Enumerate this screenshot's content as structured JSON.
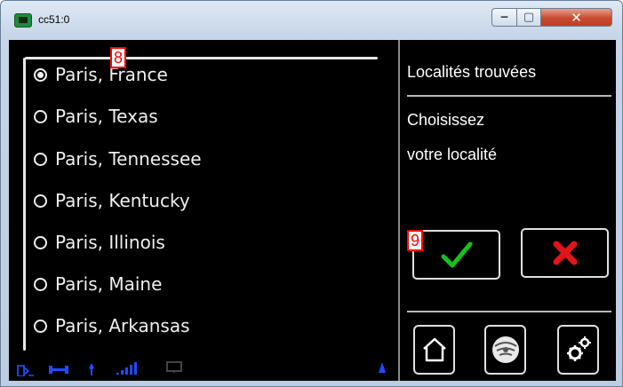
{
  "window": {
    "title": "cc51:0",
    "minimize_glyph": "‒",
    "maximize_glyph": "▢",
    "close_glyph": "✕"
  },
  "list": {
    "items": [
      {
        "label": "Paris, France",
        "selected": true
      },
      {
        "label": "Paris, Texas",
        "selected": false
      },
      {
        "label": "Paris, Tennessee",
        "selected": false
      },
      {
        "label": "Paris, Kentucky",
        "selected": false
      },
      {
        "label": "Paris, Illinois",
        "selected": false
      },
      {
        "label": "Paris, Maine",
        "selected": false
      },
      {
        "label": "Paris, Arkansas",
        "selected": false
      }
    ]
  },
  "markers": {
    "list_marker": "8",
    "ok_marker": "9"
  },
  "panel": {
    "title": "Localités trouvées",
    "line1": "Choisissez",
    "line2": "votre localité"
  },
  "colors": {
    "ok_check": "#15c21a",
    "cancel_x": "#e0141a",
    "status_blue": "#1d4cff"
  },
  "icons": {
    "ok": "check-icon",
    "cancel": "cross-icon",
    "home": "home-icon",
    "logo": "logo-icon",
    "settings": "gear-icon"
  }
}
